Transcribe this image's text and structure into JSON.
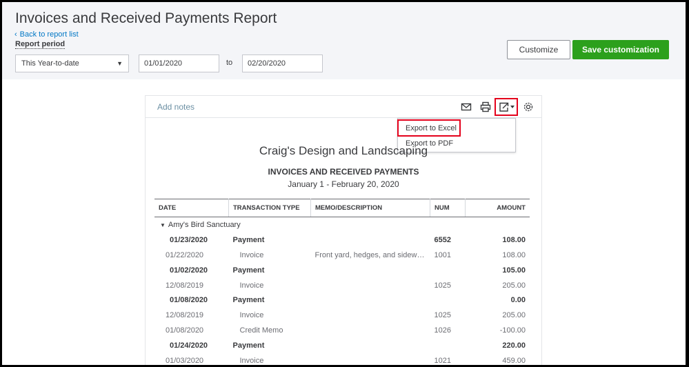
{
  "header": {
    "title": "Invoices and Received Payments Report",
    "back_link": "Back to report list",
    "period_label": "Report period",
    "period_selected": "This Year-to-date",
    "date_from": "01/01/2020",
    "to_label": "to",
    "date_to": "02/20/2020",
    "customize_label": "Customize",
    "save_label": "Save customization"
  },
  "toolbar": {
    "add_notes": "Add notes",
    "icons": [
      "mail-icon",
      "print-icon",
      "export-icon",
      "gear-icon"
    ]
  },
  "export_menu": {
    "items": [
      "Export to Excel",
      "Export to PDF"
    ]
  },
  "report": {
    "company": "Craig's Design and Landscaping",
    "title": "INVOICES AND RECEIVED PAYMENTS",
    "range": "January 1 - February 20, 2020",
    "columns": [
      "DATE",
      "TRANSACTION TYPE",
      "MEMO/DESCRIPTION",
      "NUM",
      "AMOUNT"
    ],
    "group": "Amy's Bird Sanctuary",
    "rows": [
      {
        "date": "01/23/2020",
        "type": "Payment",
        "memo": "",
        "num": "6552",
        "amount": "108.00",
        "bold": true
      },
      {
        "date": "01/22/2020",
        "type": "Invoice",
        "memo": "Front yard, hedges, and sidewalks",
        "num": "1001",
        "amount": "108.00",
        "bold": false
      },
      {
        "date": "01/02/2020",
        "type": "Payment",
        "memo": "",
        "num": "",
        "amount": "105.00",
        "bold": true
      },
      {
        "date": "12/08/2019",
        "type": "Invoice",
        "memo": "",
        "num": "1025",
        "amount": "205.00",
        "bold": false
      },
      {
        "date": "01/08/2020",
        "type": "Payment",
        "memo": "",
        "num": "",
        "amount": "0.00",
        "bold": true
      },
      {
        "date": "12/08/2019",
        "type": "Invoice",
        "memo": "",
        "num": "1025",
        "amount": "205.00",
        "bold": false
      },
      {
        "date": "01/08/2020",
        "type": "Credit Memo",
        "memo": "",
        "num": "1026",
        "amount": "-100.00",
        "bold": false
      },
      {
        "date": "01/24/2020",
        "type": "Payment",
        "memo": "",
        "num": "",
        "amount": "220.00",
        "bold": true
      },
      {
        "date": "01/03/2020",
        "type": "Invoice",
        "memo": "",
        "num": "1021",
        "amount": "459.00",
        "bold": false
      }
    ]
  },
  "colors": {
    "accent_green": "#2ca01c",
    "link_blue": "#0077c5",
    "highlight_red": "#e4001b"
  }
}
